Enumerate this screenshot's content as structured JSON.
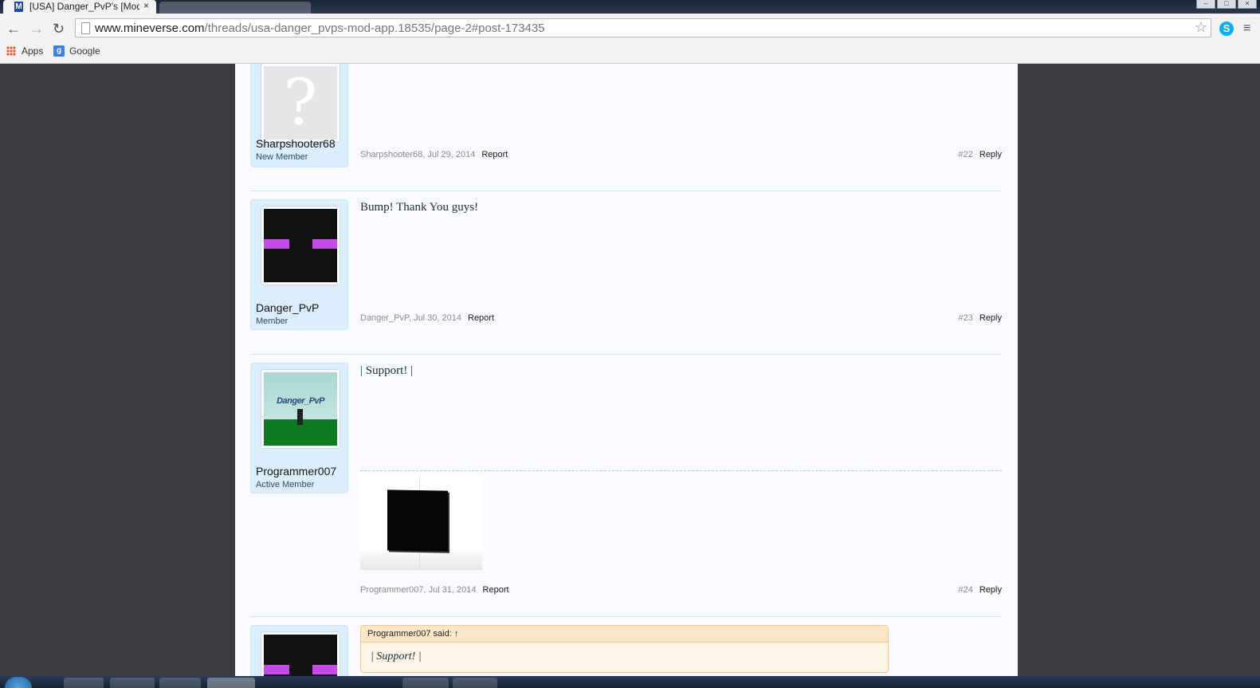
{
  "browser": {
    "active_tab_title": "[USA] Danger_PvP's [Mod",
    "tab_close": "×",
    "url_host": "www.mineverse.com",
    "url_path": "/threads/usa-danger_pvps-mod-app.18535/page-2#post-173435",
    "bookmarks": [
      {
        "label": "Apps",
        "icon": "apps-grid-icon"
      },
      {
        "label": "Google",
        "icon": "google-icon"
      }
    ]
  },
  "posts": [
    {
      "username": "Sharpshooter68",
      "user_title": "New Member",
      "avatar": "default-avatar",
      "message": "",
      "meta_author_date": "Sharpshooter68, Jul 29, 2014",
      "report_label": "Report",
      "post_number": "#22",
      "reply_label": "Reply"
    },
    {
      "username": "Danger_PvP",
      "user_title": "Member",
      "avatar": "enderman-avatar",
      "message": "Bump! Thank You guys!",
      "meta_author_date": "Danger_PvP, Jul 30, 2014",
      "report_label": "Report",
      "post_number": "#23",
      "reply_label": "Reply"
    },
    {
      "username": "Programmer007",
      "user_title": "Active Member",
      "avatar": "banner-avatar",
      "avatar_text": "Danger_PvP",
      "message": "| Support! |",
      "signature_image": "black-cube-render",
      "meta_author_date": "Programmer007, Jul 31, 2014",
      "report_label": "Report",
      "post_number": "#24",
      "reply_label": "Reply"
    },
    {
      "avatar": "enderman-avatar",
      "quote_header": "Programmer007 said: ↑",
      "quote_body": "| Support! |"
    }
  ],
  "colors": {
    "page_background": "#3b3c42",
    "content_background": "#fafbfe",
    "userinfo_background": "#dcedfb",
    "quote_background": "#fff5e7",
    "enderman_eye": "#c54be8"
  }
}
